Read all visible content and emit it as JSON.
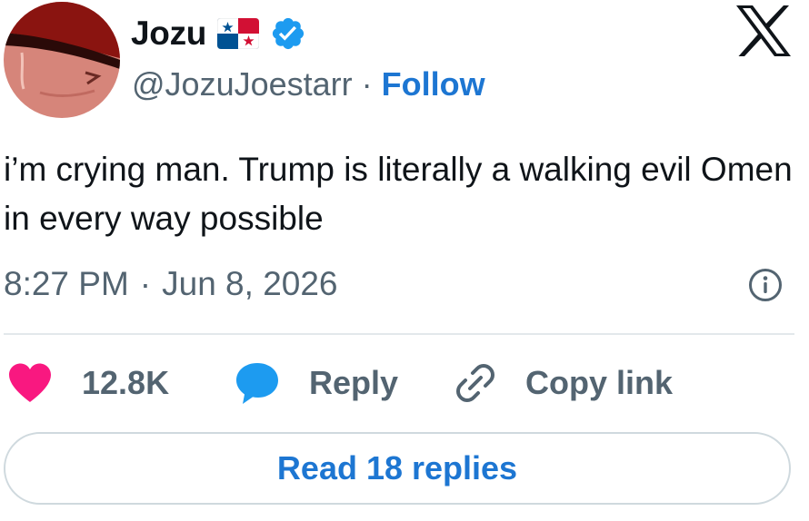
{
  "author": {
    "display_name": "Jozu",
    "handle": "@JozuJoestarr",
    "separator": "·",
    "follow_label": "Follow",
    "flag_icon": "panama-flag-icon",
    "verified_icon": "verified-badge-icon"
  },
  "tweet": {
    "text": "i’m crying man. Trump is literally a walking evil Omen in every way possible",
    "time": "8:27 PM",
    "separator": "·",
    "date": "Jun 8, 2026"
  },
  "actions": {
    "like_count": "12.8K",
    "reply_label": "Reply",
    "copy_link_label": "Copy link"
  },
  "footer": {
    "read_replies_label": "Read 18 replies"
  },
  "colors": {
    "link_blue": "#1d76d2",
    "verified_blue": "#1d9bf0",
    "like_pink": "#f91880",
    "muted_gray": "#536471",
    "divider": "#e3e8eb"
  }
}
